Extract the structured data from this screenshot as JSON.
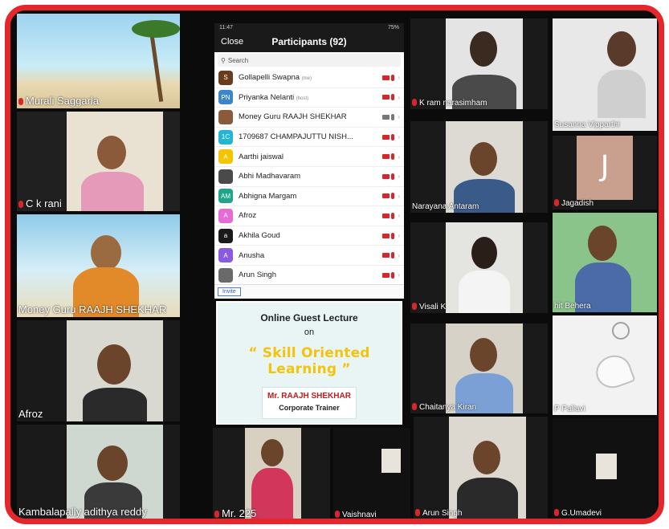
{
  "participants_panel": {
    "status_time": "11:47",
    "status_battery": "75%",
    "close_label": "Close",
    "title": "Participants (92)",
    "search_placeholder": "Search",
    "invite_label": "Invite",
    "rows": [
      {
        "initials": "S",
        "color": "#6b3b1e",
        "name": "Gollapelli Swapna",
        "tag": "(me)",
        "cam": "off",
        "mic": "off"
      },
      {
        "initials": "PN",
        "color": "#3b86c8",
        "name": "Priyanka Nelanti",
        "tag": "(host)",
        "cam": "off",
        "mic": "off"
      },
      {
        "initials": "",
        "color": "#8a5a3a",
        "name": "Money Guru RAAJH SHEKHAR",
        "tag": "",
        "cam": "on",
        "mic": "on"
      },
      {
        "initials": "1C",
        "color": "#23b5d3",
        "name": "1709687 CHAMPAJUTTU NISH...",
        "tag": "",
        "cam": "off",
        "mic": "off"
      },
      {
        "initials": "A",
        "color": "#f5c400",
        "name": "Aarthi jaiswal",
        "tag": "",
        "cam": "off",
        "mic": "off"
      },
      {
        "initials": "",
        "color": "#4a4a4a",
        "name": "Abhi Madhavaram",
        "tag": "",
        "cam": "off",
        "mic": "off"
      },
      {
        "initials": "AM",
        "color": "#1fa58a",
        "name": "Abhigna Margam",
        "tag": "",
        "cam": "off",
        "mic": "off"
      },
      {
        "initials": "A",
        "color": "#e86ad6",
        "name": "Afroz",
        "tag": "",
        "cam": "off",
        "mic": "off"
      },
      {
        "initials": "a",
        "color": "#1a1a1a",
        "name": "Akhila Goud",
        "tag": "",
        "cam": "off",
        "mic": "off"
      },
      {
        "initials": "A",
        "color": "#8a5ae0",
        "name": "Anusha",
        "tag": "",
        "cam": "off",
        "mic": "off"
      },
      {
        "initials": "",
        "color": "#6a6a6a",
        "name": "Arun Singh",
        "tag": "",
        "cam": "off",
        "mic": "off"
      }
    ]
  },
  "lecture": {
    "title": "Online Guest Lecture",
    "on": "on",
    "topic": "“ Skill Oriented Learning ”",
    "speaker": "Mr. RAAJH SHEKHAR",
    "role": "Corporate Trainer"
  },
  "tiles": {
    "murali": "Murali Saggarla",
    "rani": "C k rani",
    "moneyguru": "Money Guru RAAJH SHEKHAR",
    "afroz": "Afroz",
    "kambalapally": "Kambalapally adithya reddy",
    "mr225": "Mr. 225",
    "vaishnavi": "Vaishnavi",
    "arunsingh": "Arun Singh",
    "kram": "K ram narasimham",
    "susanna": "Susanna Vipparthi",
    "narayana": "Narayana Antaram",
    "jagadish": "Jagadish",
    "jagadish_letter": "J",
    "visali": "Visali K",
    "behera": "hit Behera",
    "chaitanya": "Chaitanya Kiran",
    "pallavi": "P Pallavi",
    "umadevi": "G.Umadevi"
  },
  "colors": {
    "frame": "#e5262b",
    "lecture_topic": "#f2c40d",
    "speaker": "#c21c1c",
    "muted": "#d9262b"
  }
}
